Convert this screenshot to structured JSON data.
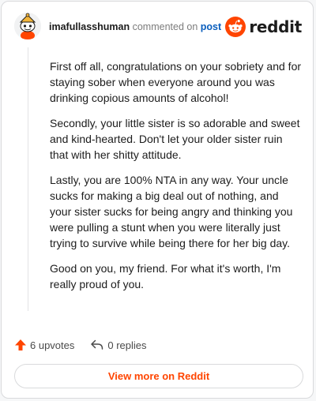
{
  "comment": {
    "username": "imafullasshuman",
    "verb": "commented on",
    "post_link": "post",
    "paragraphs": [
      "First off all, congratulations on your sobriety and for staying sober when everyone around you was drinking copious amounts of alcohol!",
      "Secondly, your little sister is so adorable and sweet and kind-hearted. Don't let your older sister ruin that with her shitty attitude.",
      "Lastly, you are 100% NTA in any way. Your uncle sucks for making a big deal out of nothing, and your sister sucks for being angry and thinking you were pulling a stunt when you were literally just trying to survive while being there for her big day.",
      "Good on you, my friend. For what it's worth, I'm really proud of you."
    ]
  },
  "brand": {
    "wordmark": "reddit",
    "accent": "#ff4500"
  },
  "actions": {
    "upvotes": "6 upvotes",
    "replies": "0 replies"
  },
  "footer": {
    "view_more_label": "View more on Reddit"
  },
  "icons": {
    "avatar": "snoo-avatar-icon",
    "logo": "reddit-logo-icon",
    "upvote": "upvote-arrow-icon",
    "reply": "reply-arrow-icon"
  }
}
